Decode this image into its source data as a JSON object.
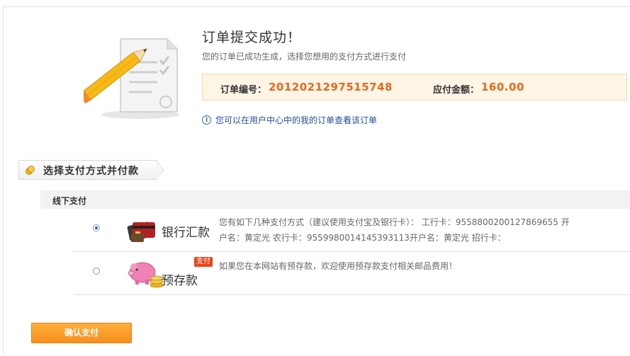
{
  "result": {
    "title": "订单提交成功！",
    "subtitle": "您的订单已成功生成，选择您想用的支付方式进行支付"
  },
  "order": {
    "number_label": "订单编号：",
    "number": "2012021297515748",
    "amount_label": "应付金额：",
    "amount": "160.00"
  },
  "hint": "您可以在用户中心中的我的订单查看该订单",
  "section": {
    "title": "选择支付方式并付款"
  },
  "offline": {
    "label": "线下支付"
  },
  "methods": [
    {
      "name": "银行汇款",
      "icon": "bank-card-icon",
      "selected": true,
      "desc_line1": "您有如下几种支付方式（建议使用支付宝及银行卡）：  工行卡：9558800200127869655 开",
      "desc_line2": "户名：黄定光 农行卡：9559980014145393113开户名：黄定光 招行卡："
    },
    {
      "name": "预存款",
      "icon": "piggy-bank-icon",
      "badge": "支付",
      "selected": false,
      "desc_line1": "如果您在本网站有预存款，欢迎使用预存款支付相关邮品费用！"
    }
  ],
  "confirm_label": "确认支付",
  "colors": {
    "accent": "#e8671a",
    "button": "#f7901e",
    "link": "#1f4e9c"
  }
}
